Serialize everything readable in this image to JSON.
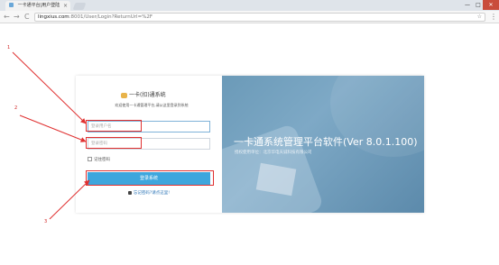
{
  "browser": {
    "tab_title": "一卡通平台|用户登陆",
    "tab_close": "×",
    "back": "←",
    "forward": "→",
    "reload": "C",
    "url_host": "lingxius.com",
    "url_path": ":8001/User/Login?ReturnUrl=%2F",
    "star": "☆",
    "menu": "⋮",
    "win_min": "—",
    "win_max": "□",
    "win_close": "✕"
  },
  "annotations": {
    "label_1": "1",
    "label_2": "2",
    "label_3": "3"
  },
  "login": {
    "brand": "一卡(扣)通系统",
    "welcome": "欢迎使用一卡通管理平台,请从这里登录到系统",
    "username_placeholder": "登录用户名",
    "password_placeholder": "登录密码",
    "remember": "记住密码",
    "submit": "登录系统",
    "forgot": "忘记密码?请点这里!"
  },
  "banner": {
    "title": "一卡通系统管理平台软件(Ver 8.0.1.100)",
    "copyright": "授权使用单位：北京华电天诚科技有限公司"
  },
  "colors": {
    "accent": "#3ea6dd",
    "annotation": "#e03030"
  }
}
